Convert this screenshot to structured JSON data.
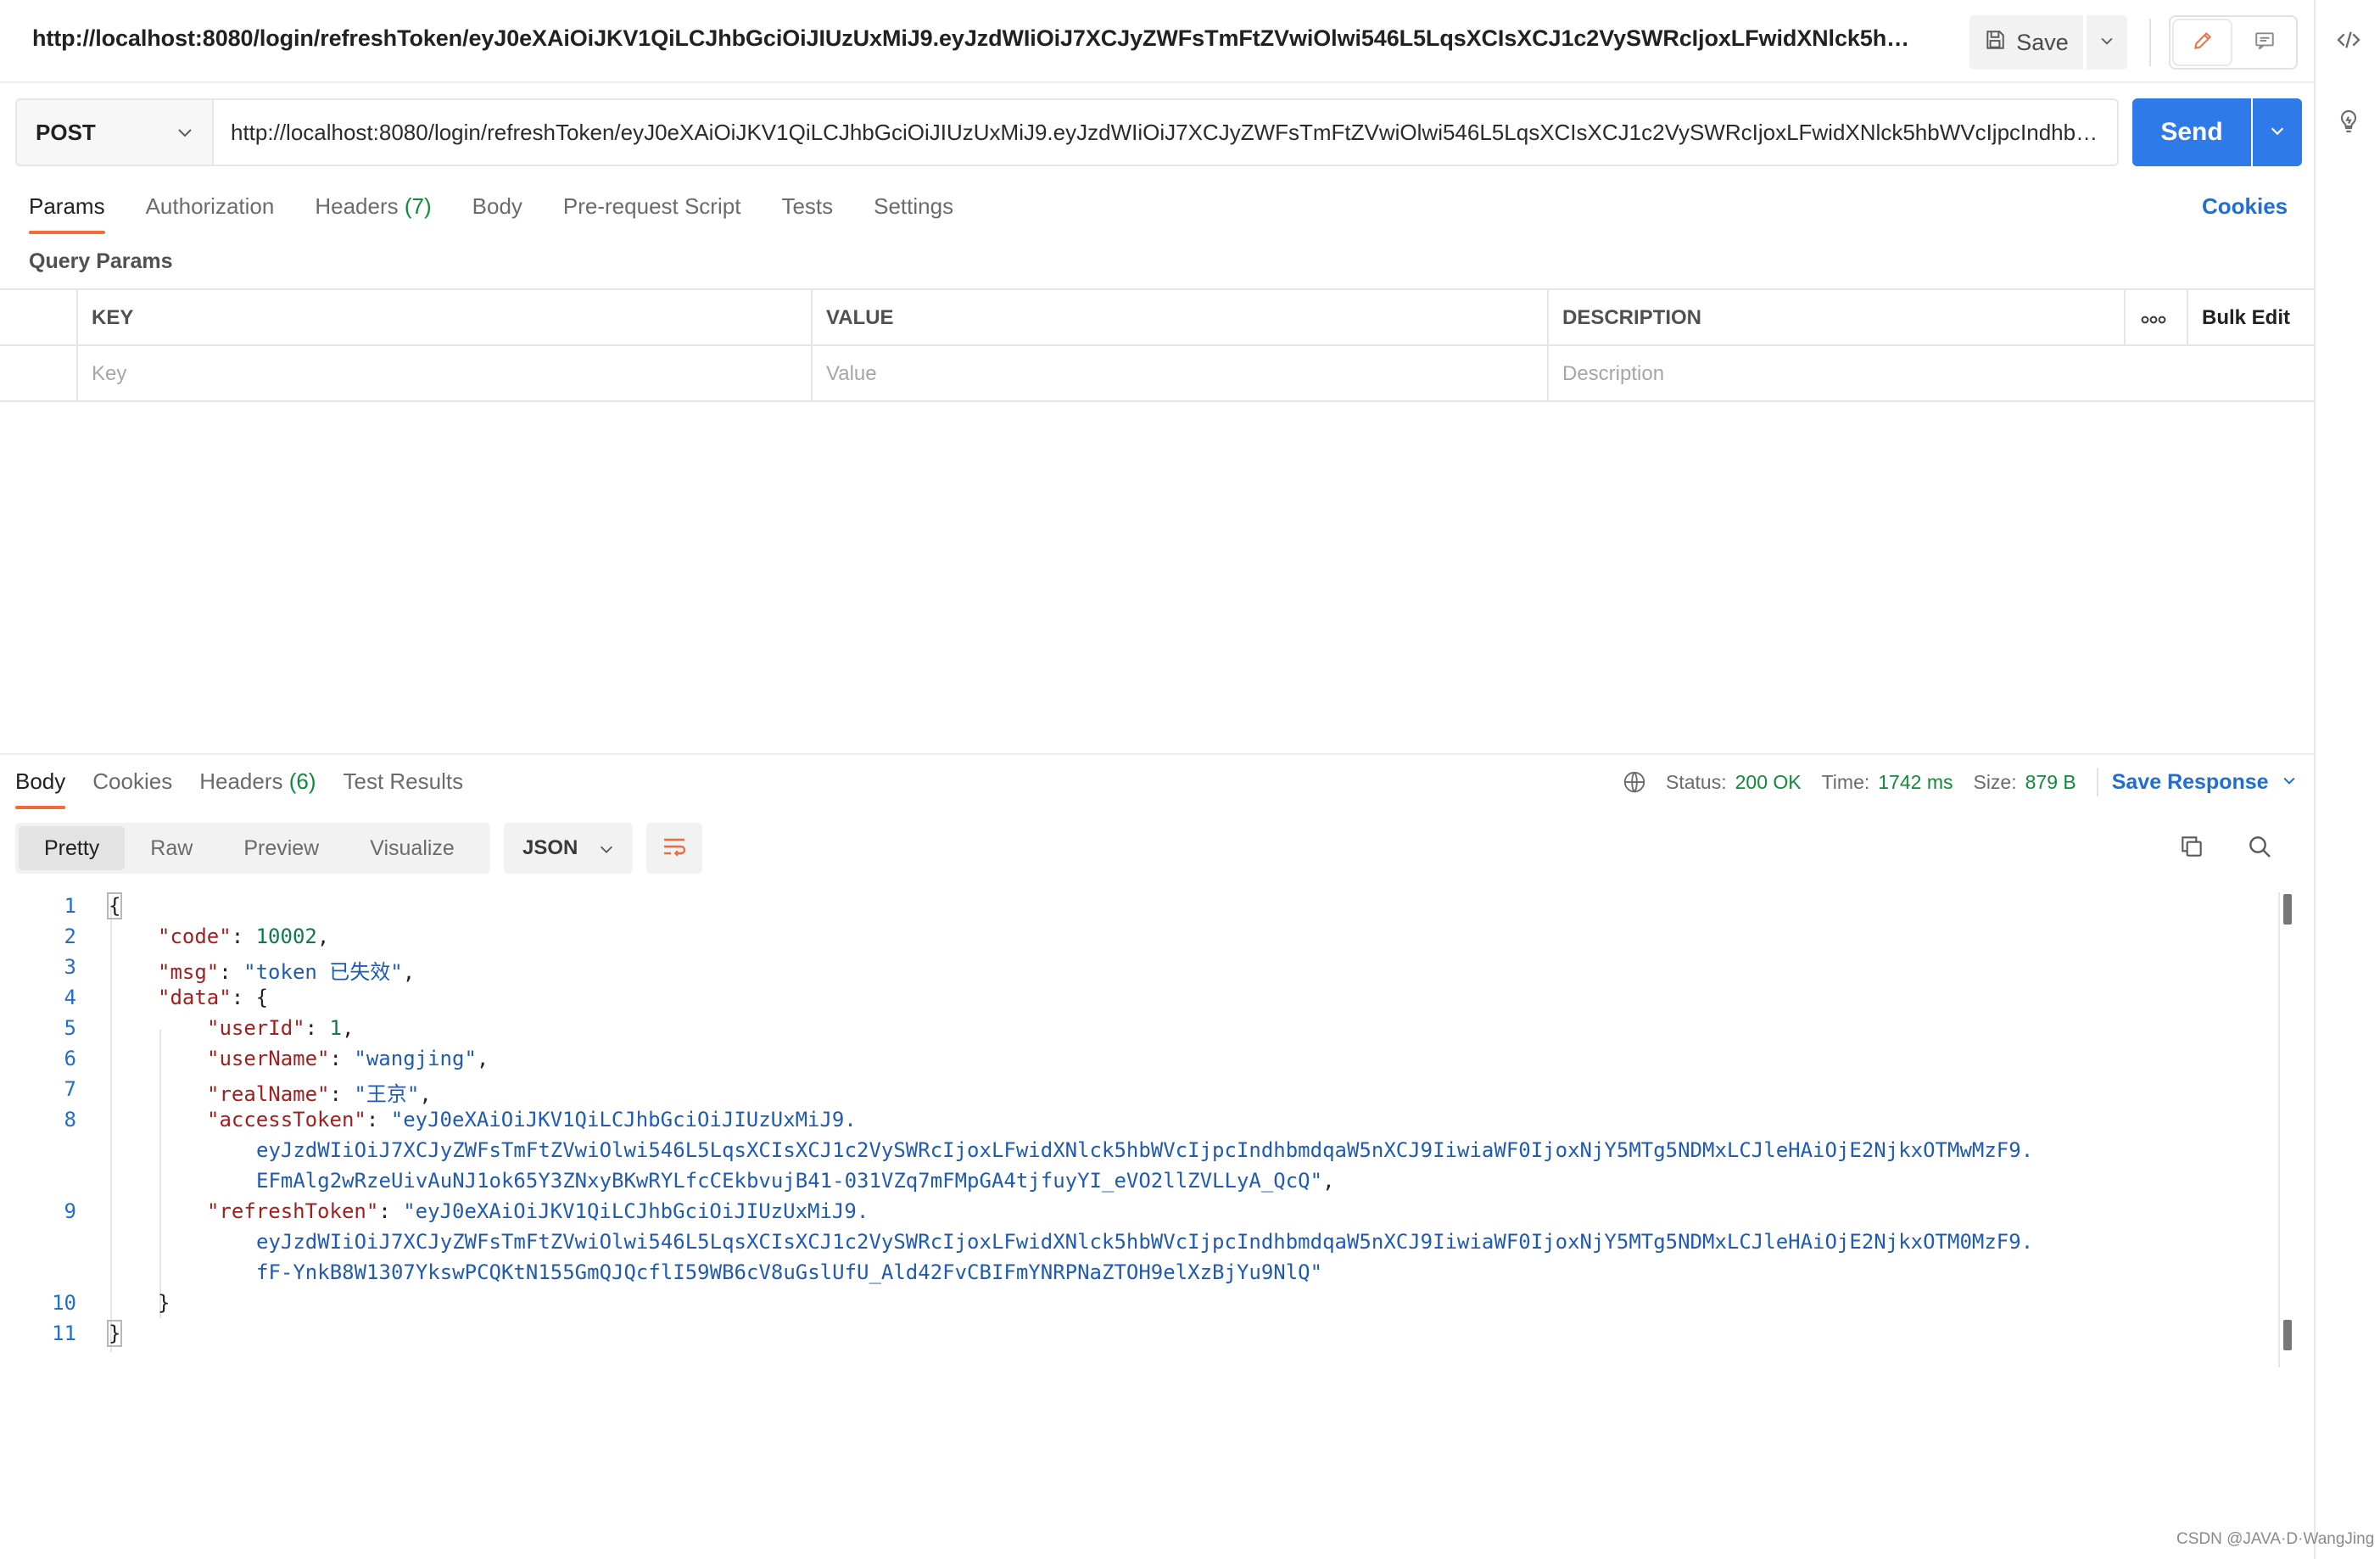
{
  "title_bar": {
    "request_name": "http://localhost:8080/login/refreshToken/eyJ0eXAiOiJKV1QiLCJhbGciOiJIUzUxMiJ9.eyJzdWIiOiJ7XCJyZWFsTmFtZVwiOlwi546L5LqsXCIsXCJ1c2VySWRcIjoxLFwidXNlck5hbWVcIjpcIndhb...",
    "save_label": "Save"
  },
  "request": {
    "method": "POST",
    "url": "http://localhost:8080/login/refreshToken/eyJ0eXAiOiJKV1QiLCJhbGciOiJIUzUxMiJ9.eyJzdWIiOiJ7XCJyZWFsTmFtZVwiOlwi546L5LqsXCIsXCJ1c2VySWRcIjoxLFwidXNlck5hbWVcIjpcIndhbmdqaW...",
    "send_label": "Send"
  },
  "request_tabs": {
    "params": "Params",
    "authorization": "Authorization",
    "headers": "Headers",
    "headers_count": "(7)",
    "body": "Body",
    "pre_request": "Pre-request Script",
    "tests": "Tests",
    "settings": "Settings",
    "cookies": "Cookies"
  },
  "query_params": {
    "label": "Query Params",
    "headers": {
      "key": "KEY",
      "value": "VALUE",
      "description": "DESCRIPTION",
      "bulk_edit": "Bulk Edit"
    },
    "placeholders": {
      "key": "Key",
      "value": "Value",
      "description": "Description"
    }
  },
  "response_tabs": {
    "body": "Body",
    "cookies": "Cookies",
    "headers": "Headers",
    "headers_count": "(6)",
    "test_results": "Test Results"
  },
  "response_status": {
    "status_label": "Status:",
    "status_value": "200 OK",
    "time_label": "Time:",
    "time_value": "1742 ms",
    "size_label": "Size:",
    "size_value": "879 B",
    "save_response": "Save Response"
  },
  "view_modes": {
    "pretty": "Pretty",
    "raw": "Raw",
    "preview": "Preview",
    "visualize": "Visualize"
  },
  "format": "JSON",
  "code": {
    "line_numbers": [
      "1",
      "2",
      "3",
      "4",
      "5",
      "6",
      "7",
      "8",
      "9",
      "10",
      "11"
    ],
    "code_key": "\"code\"",
    "code_val": "10002",
    "msg_key": "\"msg\"",
    "msg_val": "\"token 已失效\"",
    "data_key": "\"data\"",
    "userId_key": "\"userId\"",
    "userId_val": "1",
    "userName_key": "\"userName\"",
    "userName_val": "\"wangjing\"",
    "realName_key": "\"realName\"",
    "realName_val": "\"王京\"",
    "accessToken_key": "\"accessToken\"",
    "accessToken_val_1": "\"eyJ0eXAiOiJKV1QiLCJhbGciOiJIUzUxMiJ9.",
    "accessToken_val_2": "eyJzdWIiOiJ7XCJyZWFsTmFtZVwiOlwi546L5LqsXCIsXCJ1c2VySWRcIjoxLFwidXNlck5hbWVcIjpcIndhbmdqaW5nXCJ9IiwiaWF0IjoxNjY5MTg5NDMxLCJleHAiOjE2NjkxOTMwMzF9.",
    "accessToken_val_3": "EFmAlg2wRzeUivAuNJ1ok65Y3ZNxyBKwRYLfcCEkbvujB41-031VZq7mFMpGA4tjfuyYI_eVO2llZVLLyA_QcQ\"",
    "refreshToken_key": "\"refreshToken\"",
    "refreshToken_val_1": "\"eyJ0eXAiOiJKV1QiLCJhbGciOiJIUzUxMiJ9.",
    "refreshToken_val_2": "eyJzdWIiOiJ7XCJyZWFsTmFtZVwiOlwi546L5LqsXCIsXCJ1c2VySWRcIjoxLFwidXNlck5hbWVcIjpcIndhbmdqaW5nXCJ9IiwiaWF0IjoxNjY5MTg5NDMxLCJleHAiOjE2NjkxOTM0MzF9.",
    "refreshToken_val_3": "fF-YnkB8W1307YkswPCQKtN155GmQJQcflI59WB6cV8uGslUfU_Ald42FvCBIFmYNRPNaZTOH9elXzBjYu9NlQ\""
  },
  "watermark": "CSDN @JAVA·D·WangJing",
  "colors": {
    "accent": "#f26b3a",
    "send": "#2e7ae8",
    "link": "#1f6ed4",
    "success": "#0f8a3a"
  }
}
